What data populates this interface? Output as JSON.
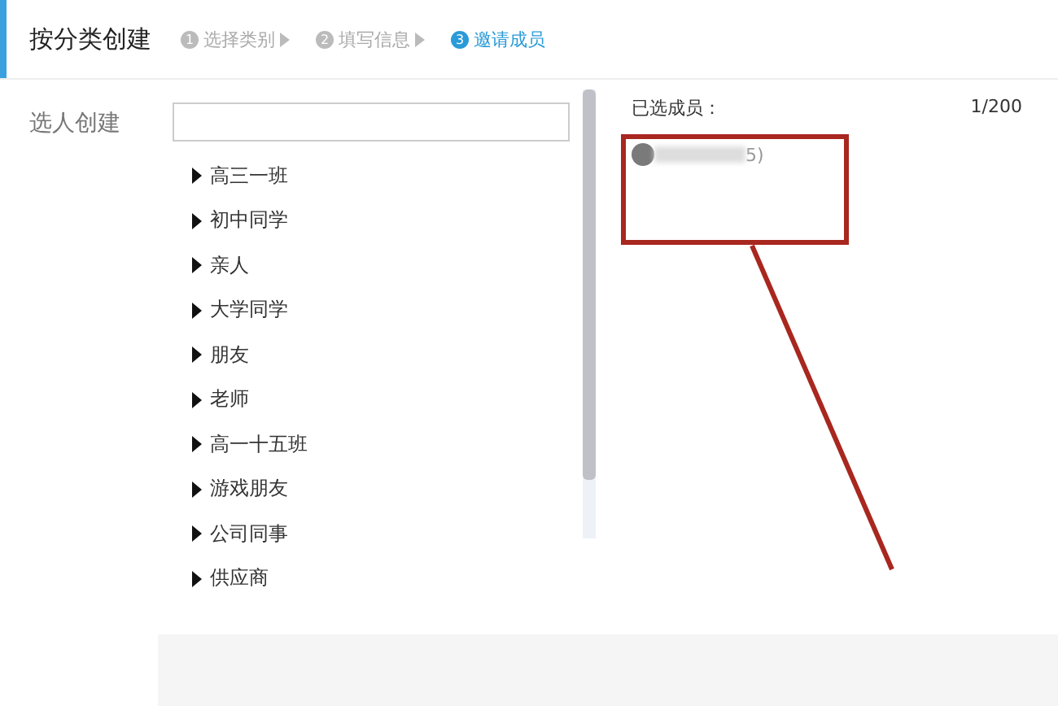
{
  "header": {
    "title": "按分类创建",
    "steps": [
      {
        "number": "1",
        "label": "选择类别",
        "selected": false
      },
      {
        "number": "2",
        "label": "填写信息",
        "selected": false
      },
      {
        "number": "3",
        "label": "邀请成员",
        "selected": true
      }
    ]
  },
  "side_label": "选人创建",
  "groups": [
    {
      "label": "高三一班",
      "expanded": false
    },
    {
      "label": "初中同学",
      "expanded": false
    },
    {
      "label": "亲人",
      "expanded": false
    },
    {
      "label": "大学同学",
      "expanded": false
    },
    {
      "label": "朋友",
      "expanded": false
    },
    {
      "label": "老师",
      "expanded": false
    },
    {
      "label": "高一十五班",
      "expanded": false
    },
    {
      "label": "游戏朋友",
      "expanded": false
    },
    {
      "label": "公司同事",
      "expanded": false
    },
    {
      "label": "供应商",
      "expanded": false
    }
  ],
  "selected_panel": {
    "title": "已选成员：",
    "count": "1/200",
    "members": [
      {
        "name_tail": "5)"
      }
    ]
  }
}
